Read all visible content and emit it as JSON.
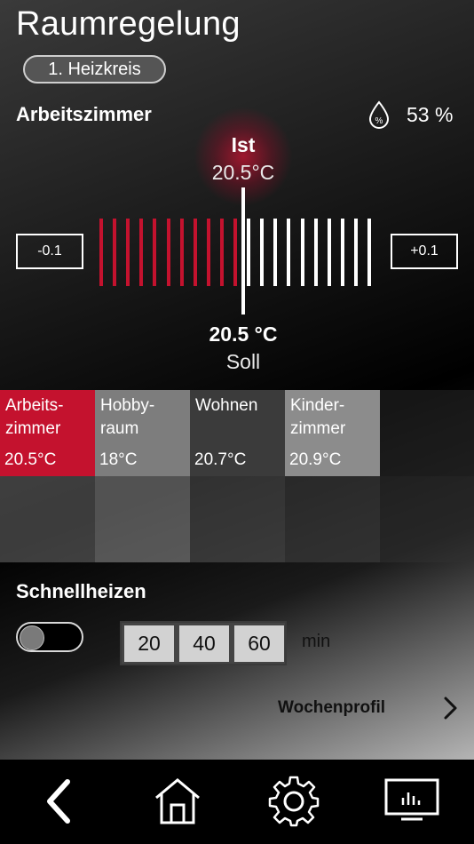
{
  "header": {
    "title": "Raumregelung",
    "circuit_label": "1. Heizkreis"
  },
  "room": {
    "name": "Arbeitszimmer",
    "humidity": "53 %",
    "humidity_icon": "humidity-drop-icon"
  },
  "actual": {
    "label": "Ist",
    "value": "20.5°C"
  },
  "setpoint": {
    "value": "20.5 °C",
    "label": "Soll"
  },
  "controls": {
    "decrease": "-0.1",
    "increase": "+0.1"
  },
  "colors": {
    "accent": "#c4122e",
    "active_bar": "#c4122e",
    "inactive_bar": "#ffffff"
  },
  "rooms": [
    {
      "name": "Arbeits-\nzimmer",
      "temp": "20.5°C",
      "active": true
    },
    {
      "name": "Hobby-\nraum",
      "temp": "18°C",
      "active": false
    },
    {
      "name": "Wohnen",
      "temp": "20.7°C",
      "active": false
    },
    {
      "name": "Kinder-\nzimmer",
      "temp": "20.9°C",
      "active": false
    }
  ],
  "quick_heat": {
    "title": "Schnellheizen",
    "enabled": false,
    "durations": [
      "20",
      "40",
      "60"
    ],
    "unit": "min"
  },
  "weekly_profile": {
    "label": "Wochenprofil"
  },
  "nav": [
    {
      "icon": "back-icon"
    },
    {
      "icon": "home-icon"
    },
    {
      "icon": "settings-gear-icon"
    },
    {
      "icon": "statistics-icon"
    }
  ]
}
